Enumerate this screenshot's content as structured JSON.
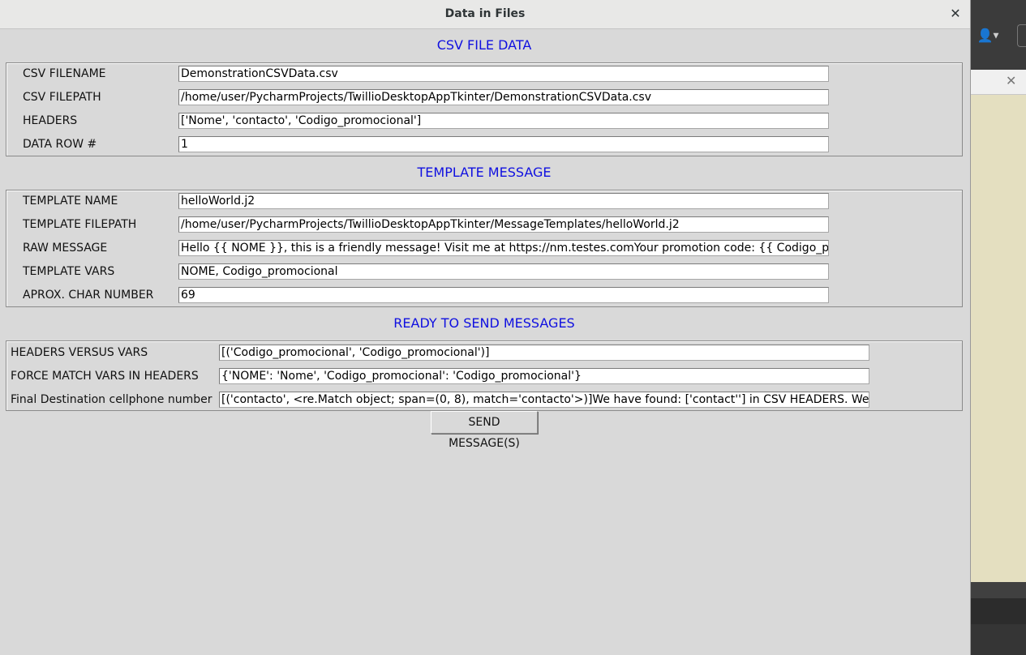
{
  "dialog": {
    "title": "Data in Files"
  },
  "csv": {
    "title": "CSV FILE DATA",
    "rows": [
      {
        "label": "CSV FILENAME",
        "value": "DemonstrationCSVData.csv"
      },
      {
        "label": "CSV FILEPATH",
        "value": "/home/user/PycharmProjects/TwillioDesktopAppTkinter/DemonstrationCSVData.csv"
      },
      {
        "label": "HEADERS",
        "value": "['Nome', 'contacto', 'Codigo_promocional']"
      },
      {
        "label": "DATA ROW #",
        "value": "1"
      }
    ]
  },
  "template": {
    "title": "TEMPLATE MESSAGE",
    "rows": [
      {
        "label": "TEMPLATE NAME",
        "value": "helloWorld.j2"
      },
      {
        "label": "TEMPLATE FILEPATH",
        "value": "/home/user/PycharmProjects/TwillioDesktopAppTkinter/MessageTemplates/helloWorld.j2"
      },
      {
        "label": "RAW MESSAGE",
        "value": "Hello {{ NOME }}, this is a friendly message! Visit me at https://nm.testes.comYour promotion code: {{ Codigo_promocional }}"
      },
      {
        "label": "TEMPLATE VARS",
        "value": "NOME, Codigo_promocional"
      },
      {
        "label": "APROX. CHAR NUMBER",
        "value": "69"
      }
    ]
  },
  "ready": {
    "title": "READY TO SEND MESSAGES",
    "rows": [
      {
        "label": "HEADERS VERSUS VARS",
        "value": "[('Codigo_promocional', 'Codigo_promocional')]"
      },
      {
        "label": "FORCE MATCH VARS IN HEADERS",
        "value": "{'NOME': 'Nome', 'Codigo_promocional': 'Codigo_promocional'}"
      },
      {
        "label": "Final Destination cellphone number",
        "value": "[('contacto', <re.Match object; span=(0, 8), match='contacto'>)]We have found:  ['contact''] in CSV HEADERS. We will use"
      }
    ],
    "send_label": "SEND MESSAGE(S)"
  },
  "icons": {
    "close": "close-icon",
    "user_menu": "user-menu-icon"
  }
}
